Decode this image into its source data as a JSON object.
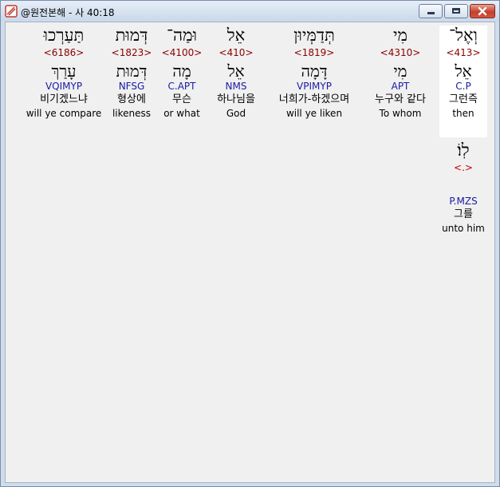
{
  "window": {
    "title": "@원전본해 - 사 40:18"
  },
  "words": [
    {
      "key": "w1",
      "hebrew": "וְאֶל־",
      "strong": "<413>",
      "lemma": "אֵל",
      "morph": "C.P",
      "korean": "그런즉",
      "english": "then"
    },
    {
      "key": "w2",
      "hebrew": "מִי",
      "strong": "<4310>",
      "lemma": "מִי",
      "morph": "APT",
      "korean": "누구와 같다",
      "english": "To whom"
    },
    {
      "key": "w3",
      "hebrew": "תְּדַמְּיוּן",
      "strong": "<1819>",
      "lemma": "דָּמָה",
      "morph": "VPIMYP",
      "korean": "너희가-하겠으며",
      "english": "will ye liken"
    },
    {
      "key": "w4",
      "hebrew": "אֵל",
      "strong": "<410>",
      "lemma": "אֵל",
      "morph": "NMS",
      "korean": "하나님을",
      "english": "God"
    },
    {
      "key": "w5",
      "hebrew": "וּמַה־",
      "strong": "<4100>",
      "lemma": "מָה",
      "morph": "C.APT",
      "korean": "무슨",
      "english": "or what"
    },
    {
      "key": "w6",
      "hebrew": "דְּמוּת",
      "strong": "<1823>",
      "lemma": "דְּמוּת",
      "morph": "NFSG",
      "korean": "형상에",
      "english": "likeness"
    },
    {
      "key": "w7",
      "hebrew": "תַּעַרְכוּ",
      "strong": "<6186>",
      "lemma": "עָרַךְ",
      "morph": "VQIMYP",
      "korean": "비기겠느냐",
      "english": "will ye compare"
    },
    {
      "key": "w8",
      "hebrew": "לֽוֹ׃",
      "strong": "<.>",
      "lemma": "ׅ",
      "morph": "P.MZS",
      "korean": "그를",
      "english": "unto him"
    }
  ]
}
